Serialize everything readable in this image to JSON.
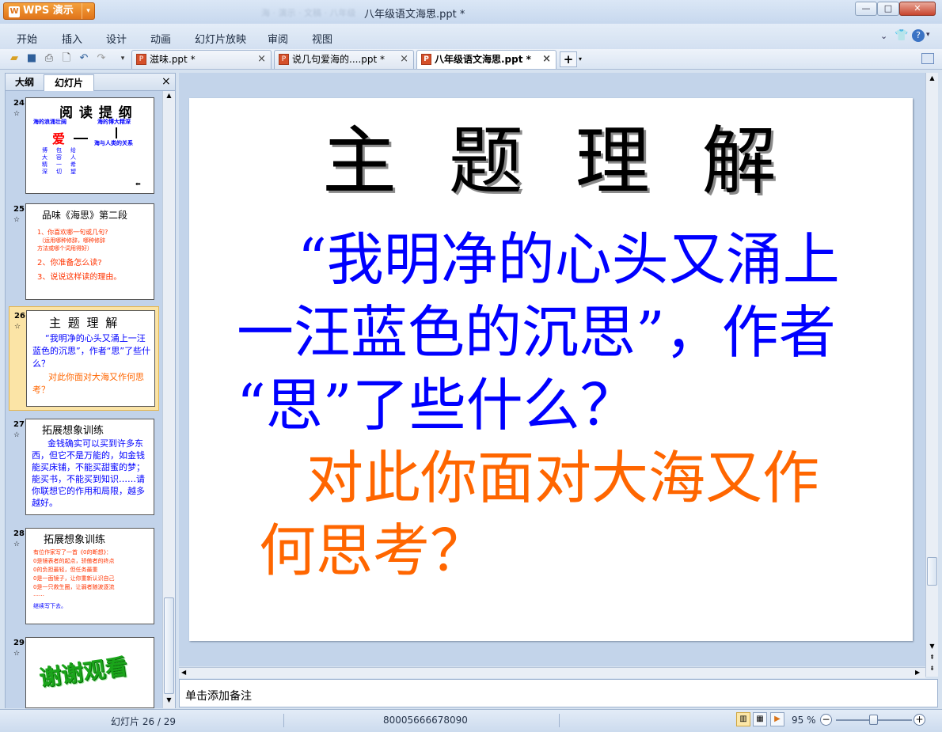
{
  "app": {
    "name": "WPS 演示",
    "logo": "W",
    "window_title": "八年级语文海思.ppt *",
    "blurred_title": "海  ·  演示  ·  文稿  ·  八年级"
  },
  "menu": [
    "开始",
    "插入",
    "设计",
    "动画",
    "幻灯片放映",
    "审阅",
    "视图"
  ],
  "doc_tabs": [
    {
      "label": "滋味.ppt *"
    },
    {
      "label": "说几句爱海的....ppt *"
    },
    {
      "label": "八年级语文海思.ppt *"
    }
  ],
  "pane_tabs": {
    "outline": "大纲",
    "slides": "幻灯片"
  },
  "thumbnails": [
    {
      "num": "24",
      "title": "阅 读 提 纲",
      "left_head": "海的浪涌壮阔",
      "mid": "爱",
      "right_head": "海的博大精深",
      "relation": "海与人类的关系",
      "cols": [
        "博大精深",
        "包容一切",
        "给人希望"
      ]
    },
    {
      "num": "25",
      "title": "品味《海思》第二段",
      "lines": [
        "1、你喜欢哪一句或几句?",
        "（运用哪种修辞，哪种修辞",
        "方法或哪个词用得好）",
        "2、你准备怎么读?",
        "3、说说这样读的理由。"
      ]
    },
    {
      "num": "26",
      "title": "主 题 理 解",
      "blue": "“我明净的心头又涌上一汪蓝色的沉思”，作者“思”了些什么？",
      "orange": "对此你面对大海又作何思考？"
    },
    {
      "num": "27",
      "title": "拓展想象训练",
      "body": "金钱确实可以买到许多东西，但它不是万能的，如金钱能买床铺，不能买甜蜜的梦；能买书，不能买到知识……请你联想它的作用和局限，越多越好。"
    },
    {
      "num": "28",
      "title": "拓展想象训练",
      "lines": [
        "有位作家写了一首《0的断想》：",
        "0是镜表者的起点，骄傲者的终点",
        "0的负担最轻，但任务最重",
        "0是一面镜子，让你重新认识自己",
        "0是一只救生圈，让弱者随波逐流",
        "……",
        "继续写下去。"
      ]
    },
    {
      "num": "29",
      "title": "谢谢观看"
    }
  ],
  "slide": {
    "title": "主 题 理 解",
    "blue_lines": [
      "“我明净的心头又涌上",
      "一汪蓝色的沉思”，作者",
      "“思”了些什么？"
    ],
    "orange_lines": [
      "对此你面对大海又作",
      "何思考？"
    ],
    "colors": {
      "title": "#000000",
      "question": "#0000ff",
      "prompt": "#ff6600"
    }
  },
  "notes": {
    "placeholder": "单击添加备注"
  },
  "status": {
    "slide_counter": "幻灯片 26 / 29",
    "info": "80005666678090",
    "zoom": "95 %",
    "zoom_level": 0.5
  }
}
